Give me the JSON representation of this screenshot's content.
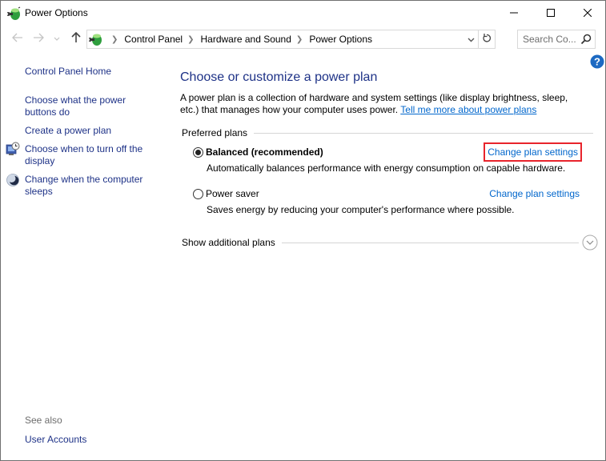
{
  "window": {
    "title": "Power Options",
    "icon": "power-options-icon",
    "controls": {
      "minimize": "minimize-icon",
      "maximize": "maximize-icon",
      "close": "close-icon"
    }
  },
  "navigation": {
    "back": "back-arrow-icon",
    "forward": "forward-arrow-icon",
    "recent": "chevron-down-icon",
    "up": "up-arrow-icon",
    "breadcrumb": [
      {
        "label": "Control Panel"
      },
      {
        "label": "Hardware and Sound"
      },
      {
        "label": "Power Options"
      }
    ],
    "dropdown_icon": "chevron-down-icon",
    "refresh_icon": "refresh-icon",
    "search": {
      "placeholder": "Search Co...",
      "value": "",
      "icon": "search-icon"
    }
  },
  "help": {
    "icon": "help-icon",
    "label": "?"
  },
  "sidebar": {
    "home": "Control Panel Home",
    "items": [
      {
        "label": "Choose what the power buttons do",
        "line1": "Choose what the power",
        "line2": "buttons do",
        "icon": null
      },
      {
        "label": "Create a power plan",
        "line1": "Create a power plan",
        "icon": null
      },
      {
        "label": "Choose when to turn off the display",
        "line1": "Choose when to turn off the",
        "line2": "display",
        "icon": "display-clock-icon"
      },
      {
        "label": "Change when the computer sleeps",
        "line1": "Change when the computer",
        "line2": "sleeps",
        "icon": "sleep-moon-icon"
      }
    ],
    "see_also": {
      "heading": "See also",
      "links": [
        {
          "label": "User Accounts"
        }
      ]
    }
  },
  "main": {
    "title": "Choose or customize a power plan",
    "description": "A power plan is a collection of hardware and system settings (like display brightness, sleep, etc.) that manages how your computer uses power.",
    "description_link": "Tell me more about power plans",
    "preferred_plans_label": "Preferred plans",
    "plans": [
      {
        "name": "Balanced (recommended)",
        "selected": true,
        "description": "Automatically balances performance with energy consumption on capable hardware.",
        "link": "Change plan settings",
        "highlighted": true
      },
      {
        "name": "Power saver",
        "selected": false,
        "description": "Saves energy by reducing your computer's performance where possible.",
        "link": "Change plan settings",
        "highlighted": false
      }
    ],
    "show_additional_label": "Show additional plans",
    "expand_icon": "chevron-down-circle-icon"
  },
  "colors": {
    "link": "#0066cc",
    "nav_link": "#1e3287",
    "title": "#1e3287",
    "highlight_box": "#e8242c",
    "help_icon": "#1c69c2"
  }
}
